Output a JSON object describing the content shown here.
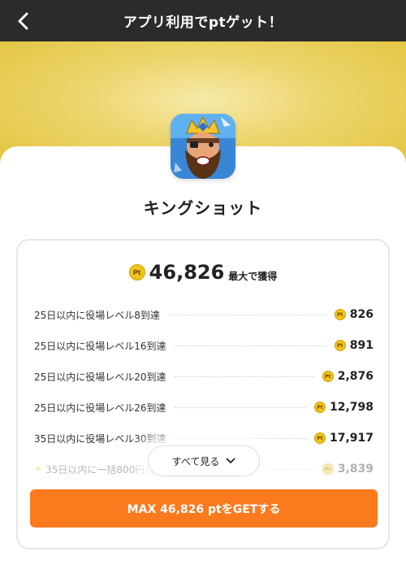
{
  "header": {
    "title": "アプリ利用でptゲット！"
  },
  "app": {
    "name": "キングショット"
  },
  "reward": {
    "total": "46,826",
    "suffix": "最大で獲得"
  },
  "tasks": [
    {
      "label": "25日以内に役場レベル8到達",
      "points": "826"
    },
    {
      "label": "25日以内に役場レベル16到達",
      "points": "891"
    },
    {
      "label": "25日以内に役場レベル20到達",
      "points": "2,876"
    },
    {
      "label": "25日以内に役場レベル26到達",
      "points": "12,798"
    },
    {
      "label": "35日以内に役場レベル30到達",
      "points": "17,917"
    },
    {
      "label": "35日以内に一括800円以",
      "points": "3,839"
    }
  ],
  "see_all": {
    "label": "すべて見る"
  },
  "cta": {
    "label": "MAX 46,826 ptをGETする"
  },
  "icons": {
    "coin": "Pt",
    "back": "chevron-left-icon",
    "expand": "chevron-down-icon"
  },
  "colors": {
    "header_bg": "#2b2b2b",
    "banner": "#e8cf55",
    "cta": "#fb7a1e",
    "coin": "#f0c419"
  }
}
